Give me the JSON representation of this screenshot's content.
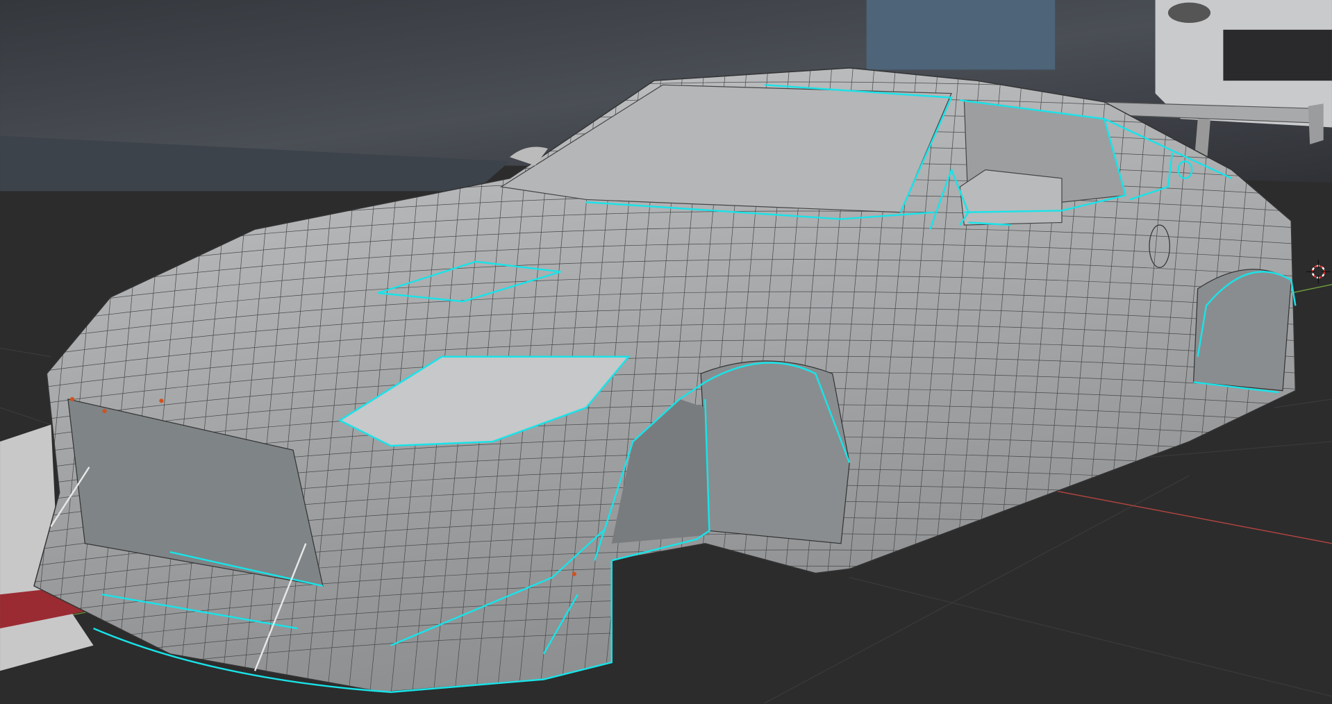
{
  "viewport": {
    "kind": "3d-viewport",
    "mode": "edit-mode-wireframe-overlay",
    "colors": {
      "floor": "#2d2d2d",
      "backdrop": "#3b3e44",
      "body": "#a9abad",
      "wire": "#3a3a3a",
      "selected_edge": "#19e3e8",
      "x_axis": "#b0443f",
      "y_axis": "#6f9a3c",
      "reference_sky": "#4d6479",
      "reference_photo": "#c9cacc"
    },
    "icons": {
      "cursor": "3d-cursor-icon"
    }
  }
}
